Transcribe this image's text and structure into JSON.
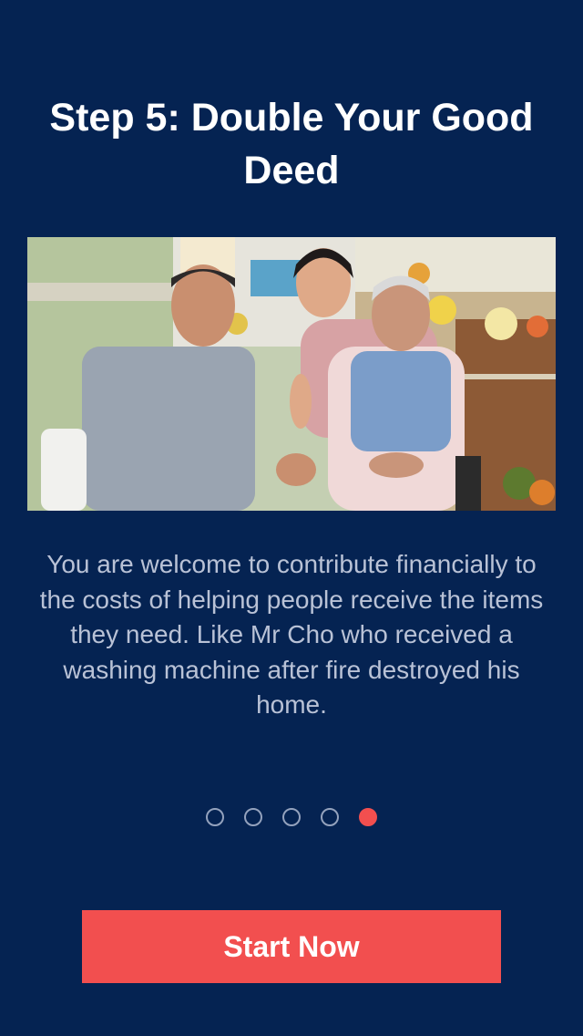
{
  "title": "Step 5: Double Your Good Deed",
  "photo": {
    "description_icon": "photo-of-elderly-residents-and-volunteer"
  },
  "description": "You are welcome to contribute financially to the costs of helping people receive the items they need. Like Mr Cho who received a washing machine after fire destroyed his home.",
  "pagination": {
    "total": 5,
    "current": 5
  },
  "start_button": {
    "label": "Start Now"
  },
  "colors": {
    "background": "#052352",
    "accent": "#f24f4f",
    "text": "#ffffff",
    "body_text": "#b9c2d6",
    "dot_inactive": "#94a2bd"
  }
}
